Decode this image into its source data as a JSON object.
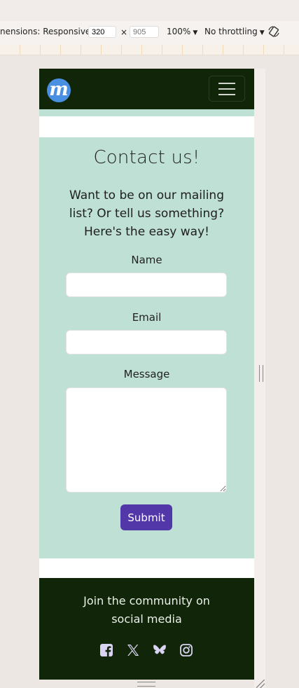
{
  "devtools": {
    "dimensions_label": "nensions: Responsive",
    "width_value": "320",
    "times": "×",
    "height_placeholder": "905",
    "zoom": "100%",
    "throttling": "No throttling"
  },
  "nav": {
    "logo_letter": "m",
    "logo_color": "#4a90e2",
    "background": "#112508"
  },
  "contact": {
    "title": "Contact us!",
    "intro": "Want to be on our mailing list? Or tell us something? Here's the easy way!",
    "name_label": "Name",
    "email_label": "Email",
    "message_label": "Message",
    "submit_label": "Submit",
    "background": "#bfe0d4",
    "accent": "#5137a8"
  },
  "footer": {
    "text": "Join the community on social media",
    "socials": [
      "facebook-icon",
      "x-icon",
      "bluesky-icon",
      "instagram-icon"
    ]
  }
}
